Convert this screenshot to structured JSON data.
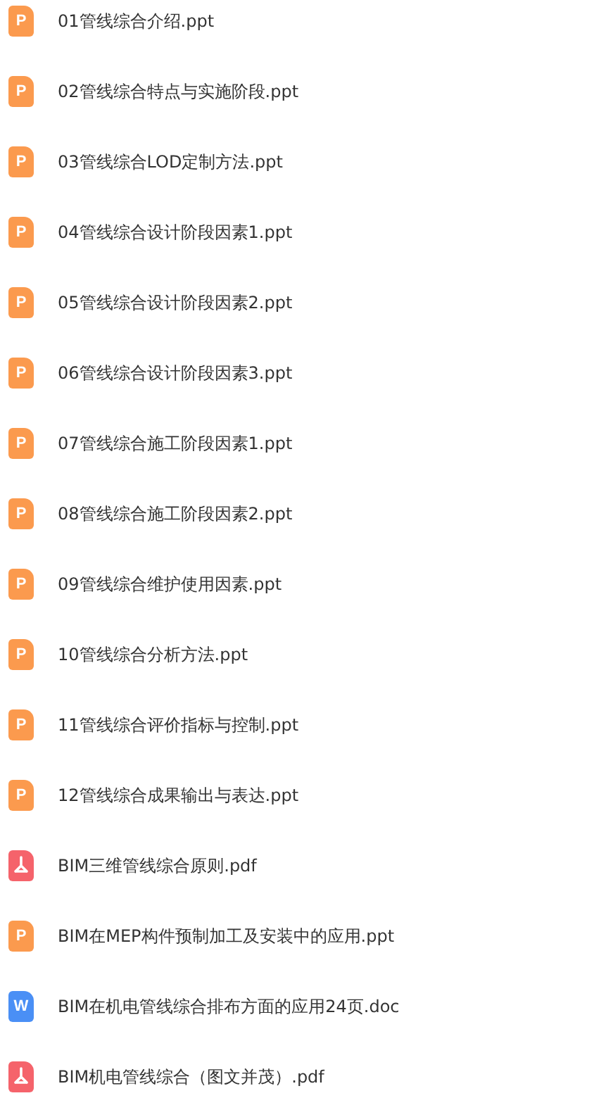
{
  "files": [
    {
      "name": "01管线综合介绍.ppt",
      "kind": "ppt",
      "icon_text": "P"
    },
    {
      "name": "02管线综合特点与实施阶段.ppt",
      "kind": "ppt",
      "icon_text": "P"
    },
    {
      "name": "03管线综合LOD定制方法.ppt",
      "kind": "ppt",
      "icon_text": "P"
    },
    {
      "name": "04管线综合设计阶段因素1.ppt",
      "kind": "ppt",
      "icon_text": "P"
    },
    {
      "name": "05管线综合设计阶段因素2.ppt",
      "kind": "ppt",
      "icon_text": "P"
    },
    {
      "name": "06管线综合设计阶段因素3.ppt",
      "kind": "ppt",
      "icon_text": "P"
    },
    {
      "name": "07管线综合施工阶段因素1.ppt",
      "kind": "ppt",
      "icon_text": "P"
    },
    {
      "name": "08管线综合施工阶段因素2.ppt",
      "kind": "ppt",
      "icon_text": "P"
    },
    {
      "name": "09管线综合维护使用因素.ppt",
      "kind": "ppt",
      "icon_text": "P"
    },
    {
      "name": "10管线综合分析方法.ppt",
      "kind": "ppt",
      "icon_text": "P"
    },
    {
      "name": "11管线综合评价指标与控制.ppt",
      "kind": "ppt",
      "icon_text": "P"
    },
    {
      "name": "12管线综合成果输出与表达.ppt",
      "kind": "ppt",
      "icon_text": "P"
    },
    {
      "name": "BIM三维管线综合原则.pdf",
      "kind": "pdf"
    },
    {
      "name": "BIM在MEP构件预制加工及安装中的应用.ppt",
      "kind": "ppt",
      "icon_text": "P"
    },
    {
      "name": "BIM在机电管线综合排布方面的应用24页.doc",
      "kind": "doc",
      "icon_text": "W"
    },
    {
      "name": "BIM机电管线综合（图文并茂）.pdf",
      "kind": "pdf"
    }
  ]
}
